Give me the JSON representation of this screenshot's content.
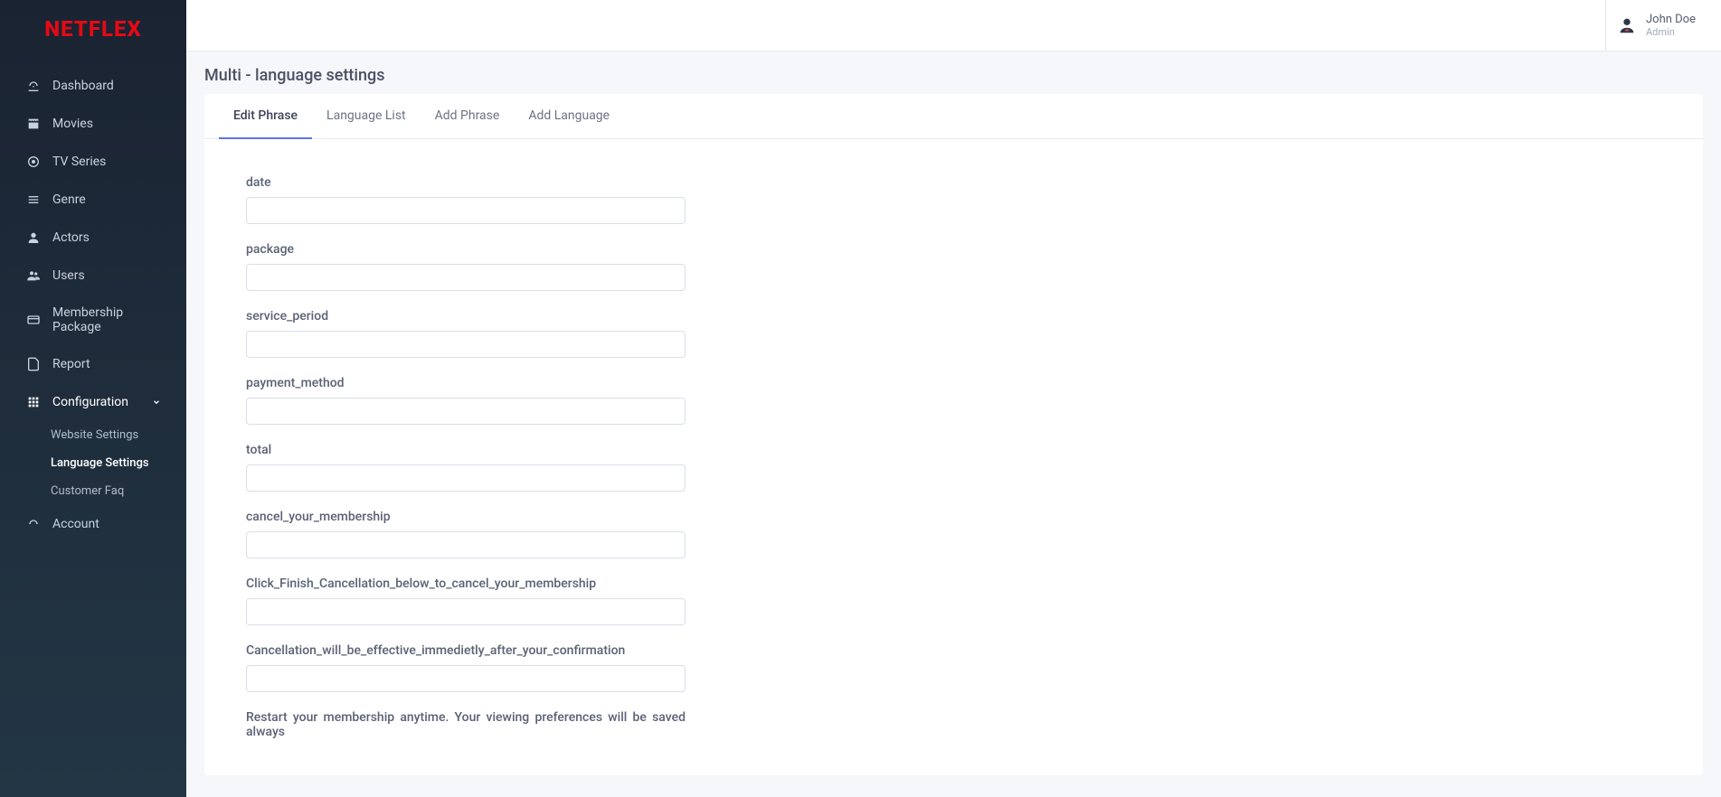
{
  "brand": "NETFLEX",
  "user": {
    "name": "John Doe",
    "role": "Admin"
  },
  "sidebar": {
    "items": [
      {
        "label": "Dashboard",
        "icon": "dashboard"
      },
      {
        "label": "Movies",
        "icon": "movie"
      },
      {
        "label": "TV Series",
        "icon": "tv"
      },
      {
        "label": "Genre",
        "icon": "list"
      },
      {
        "label": "Actors",
        "icon": "person"
      },
      {
        "label": "Users",
        "icon": "people"
      },
      {
        "label": "Membership Package",
        "icon": "card"
      },
      {
        "label": "Report",
        "icon": "report"
      },
      {
        "label": "Configuration",
        "icon": "grid",
        "expanded": true,
        "sub": [
          {
            "label": "Website Settings"
          },
          {
            "label": "Language Settings",
            "active": true
          },
          {
            "label": "Customer Faq"
          }
        ]
      },
      {
        "label": "Account",
        "icon": "account"
      }
    ]
  },
  "page": {
    "title": "Multi - language settings"
  },
  "tabs": [
    {
      "label": "Edit Phrase",
      "active": true
    },
    {
      "label": "Language List"
    },
    {
      "label": "Add Phrase"
    },
    {
      "label": "Add Language"
    }
  ],
  "form_fields": [
    {
      "label": "date",
      "value": ""
    },
    {
      "label": "package",
      "value": ""
    },
    {
      "label": "service_period",
      "value": ""
    },
    {
      "label": "payment_method",
      "value": ""
    },
    {
      "label": "total",
      "value": ""
    },
    {
      "label": "cancel_your_membership",
      "value": ""
    },
    {
      "label": "Click_Finish_Cancellation_below_to_cancel_your_membership",
      "value": ""
    },
    {
      "label": "Cancellation_will_be_effective_immedietly_after_your_confirmation",
      "value": ""
    }
  ],
  "cutoff_label": "Restart your membership anytime. Your viewing preferences will be saved always"
}
